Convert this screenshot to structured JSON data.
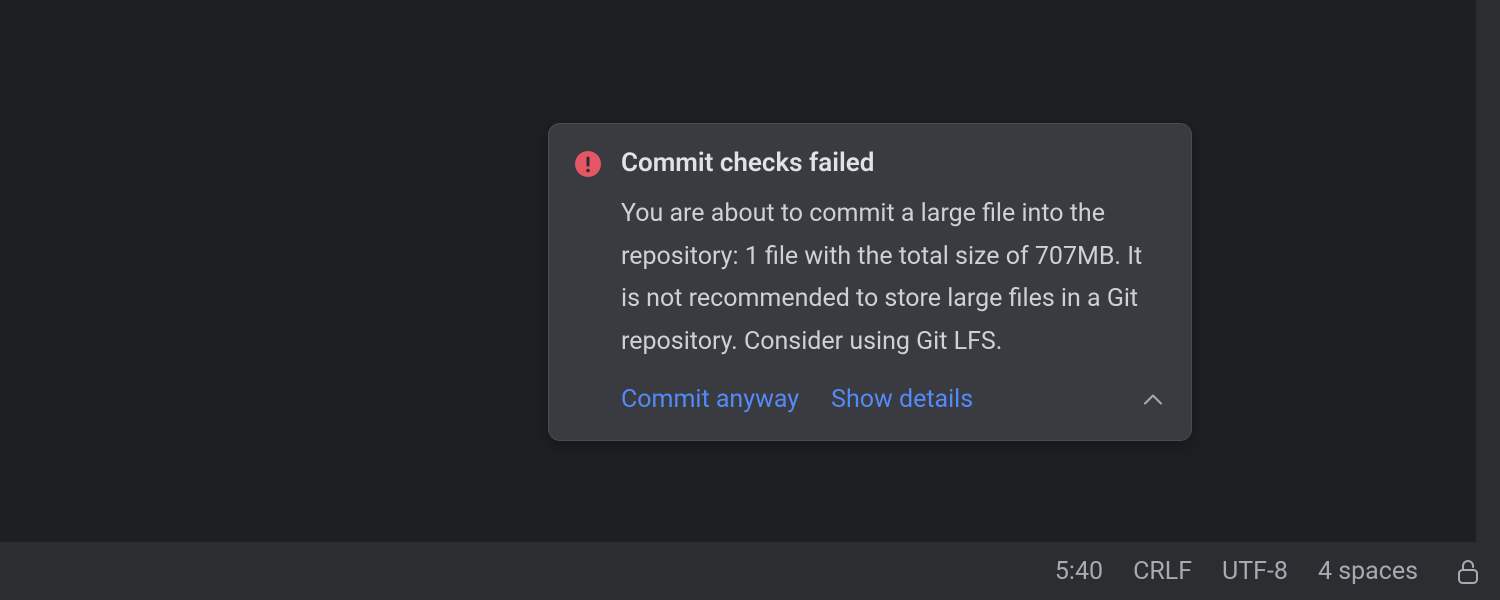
{
  "notification": {
    "title": "Commit checks failed",
    "body": "You are about to commit a large file into the repository: 1 file with the total size of 707MB. It is not recommended to store large files in a Git repository. Consider using Git LFS.",
    "actions": {
      "commit_anyway": "Commit anyway",
      "show_details": "Show details"
    }
  },
  "status_bar": {
    "cursor_position": "5:40",
    "line_separator": "CRLF",
    "encoding": "UTF-8",
    "indent": "4 spaces"
  },
  "colors": {
    "error": "#e55765",
    "link": "#548af7"
  }
}
